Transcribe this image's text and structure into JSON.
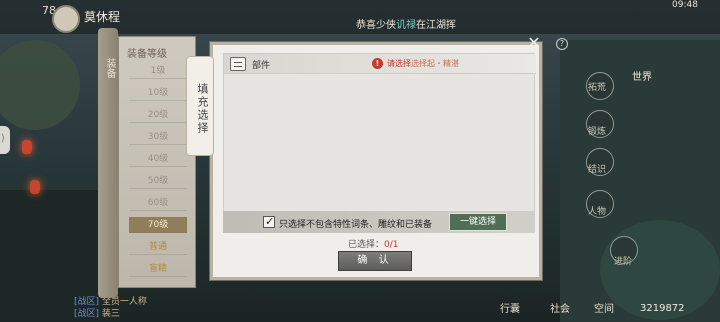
{
  "topbar": {
    "player_level": "78",
    "player_name": "莫休程",
    "announcement_prefix": "恭喜少侠",
    "announcement_highlight": "讥禄",
    "announcement_suffix": "在江湖挥",
    "clock": "09:48"
  },
  "right_panel": {
    "world": "世界",
    "items": [
      "拓荒",
      "锻炼",
      "结识",
      "人物",
      "进阶"
    ],
    "bottom": [
      "行囊",
      "社会",
      "空间"
    ],
    "score": "3219872"
  },
  "left_levels": {
    "title": "装备等级",
    "side_label": "装备",
    "levels": [
      "1级",
      "10级",
      "20级",
      "30级",
      "40级",
      "50级",
      "60级",
      "70级",
      "普通",
      "盲精"
    ],
    "selected_index": 7
  },
  "dialog": {
    "vertical_tab": "填充选择",
    "part_label": "部件",
    "warning_text": "请选择",
    "warning_highlight": "选择起・精湛",
    "filter_label": "只选择不包含特性词条、雕纹和已装备",
    "one_key_button": "一键选择",
    "selected_label": "已选择：",
    "selected_count": "0/1",
    "confirm_button": "确 认",
    "bg_number": "376",
    "bg_number2": "236"
  },
  "chat": {
    "line1_prefix": "[战区]",
    "line1": "全员一人称",
    "line2_prefix": "[战区]",
    "line2": "装三"
  },
  "colors": {
    "confirm_bg": "#6e6e6a",
    "one_key_bg": "#4f6e55",
    "warning": "#c1392b",
    "selected_level": "#8f7e5a"
  }
}
